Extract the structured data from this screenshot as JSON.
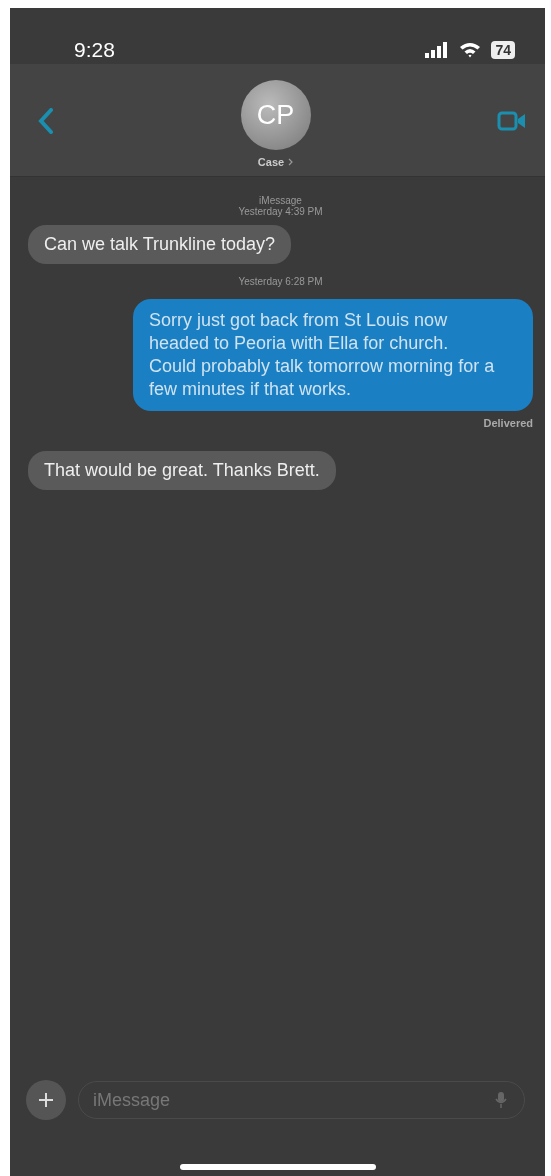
{
  "status_bar": {
    "time": "9:28",
    "battery": "74"
  },
  "header": {
    "avatar_initials": "CP",
    "contact_name": "Case"
  },
  "thread": [
    {
      "kind": "timestamp",
      "label": "iMessage",
      "text": "Yesterday 4:39 PM"
    },
    {
      "kind": "received",
      "text": "Can we talk Trunkline today?"
    },
    {
      "kind": "timestamp",
      "text": "Yesterday 6:28 PM"
    },
    {
      "kind": "sent",
      "text": "Sorry just got back from St Louis now headed to Peoria with Ella for church. Could probably talk tomorrow morning for a few minutes if that works.",
      "status": "Delivered"
    },
    {
      "kind": "received",
      "text": "That would be great. Thanks Brett."
    }
  ],
  "composer": {
    "placeholder": "iMessage"
  }
}
